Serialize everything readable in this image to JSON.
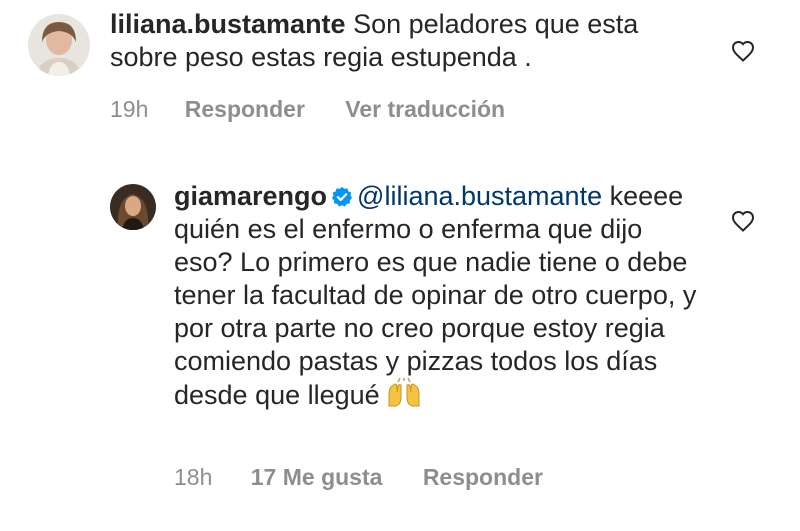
{
  "comments": [
    {
      "username": "liliana.bustamante",
      "text": "Son peladores que esta sobre peso estas regia estupenda .",
      "time": "19h",
      "reply_label": "Responder",
      "translate_label": "Ver traducción"
    },
    {
      "username": "giamarengo",
      "verified": true,
      "mention": "@liliana.bustamante",
      "text": "keeee quién es el enfermo o enferma que dijo eso? Lo primero es que nadie tiene o debe tener la facultad de opinar de otro cuerpo, y por otra parte no creo porque estoy regia comiendo pastas y pizzas todos los días desde que llegué",
      "emoji": "raising-hands-icon",
      "time": "18h",
      "likes_label": "17 Me gusta",
      "reply_label": "Responder"
    }
  ],
  "colors": {
    "text": "#262626",
    "meta": "#8e8e8e",
    "mention": "#00376b",
    "verified": "#0095f6"
  }
}
